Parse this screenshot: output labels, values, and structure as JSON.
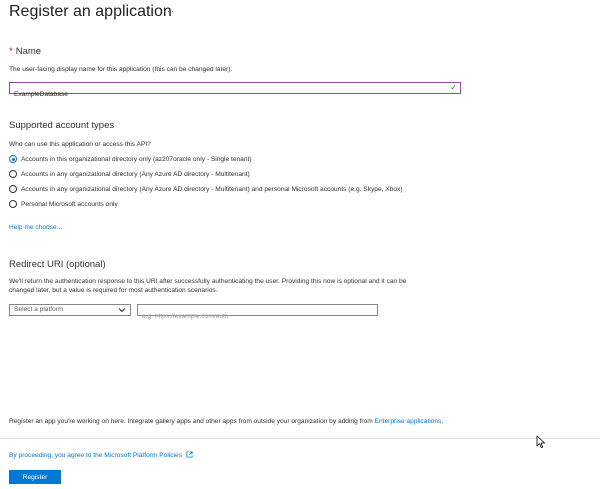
{
  "header": {
    "title": "Register an application",
    "more_glyph": "···"
  },
  "name_section": {
    "required_mark": "*",
    "label": "Name",
    "help": "The user-facing display name for this application (this can be changed later).",
    "value": "ExampleDatabase"
  },
  "account_types": {
    "title": "Supported account types",
    "question": "Who can use this application or access this API?",
    "options": [
      {
        "label": "Accounts in this organizational directory only (az207oracle only - Single tenant)",
        "selected": true
      },
      {
        "label": "Accounts in any organizational directory (Any Azure AD directory - Multitenant)",
        "selected": false
      },
      {
        "label": "Accounts in any organizational directory (Any Azure AD directory - Multitenant) and personal Microsoft accounts (e.g. Skype, Xbox)",
        "selected": false
      },
      {
        "label": "Personal Microsoft accounts only",
        "selected": false
      }
    ],
    "help_link": "Help me choose..."
  },
  "redirect": {
    "title": "Redirect URI (optional)",
    "description_line1": "We'll return the authentication response to this URI after successfully authenticating the user. Providing this now is optional and it can be",
    "description_line2": "changed later, but a value is required for most authentication scenarios.",
    "platform_select": "Select a platform",
    "uri_placeholder": "e.g. https://example.com/auth",
    "uri_value": ""
  },
  "footer": {
    "note_prefix": "Register an app you're working on here. Integrate gallery apps and other apps from outside your organization by adding from ",
    "note_link": "Enterprise applications",
    "note_suffix": ".",
    "policy_text": "By proceeding, you agree to the Microsoft Platform Policies",
    "register_label": "Register"
  },
  "colors": {
    "accent": "#0078d4",
    "focus_border": "#8a4f9e",
    "valid_check": "#107c10",
    "required": "#a4262c"
  }
}
